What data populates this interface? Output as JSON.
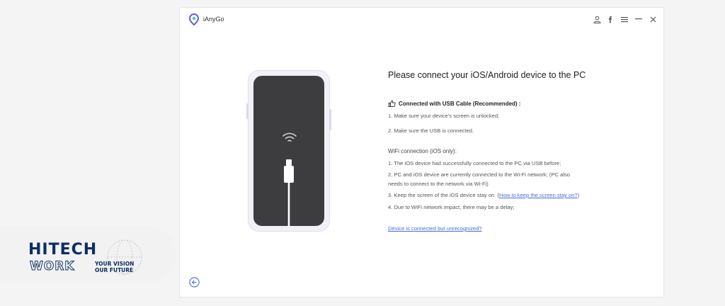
{
  "app": {
    "title": "iAnyGo",
    "accent": "#4a6bd8"
  },
  "titlebar": {
    "icons": [
      "user-icon",
      "facebook-icon",
      "menu-icon",
      "minimize-icon",
      "close-icon"
    ]
  },
  "phone": {
    "icons": [
      "wifi-icon",
      "usb-cable-icon"
    ]
  },
  "content": {
    "heading": "Please connect your iOS/Android device to the PC",
    "usb": {
      "title": "Connected with USB Cable (Recommended) :",
      "steps": [
        "1. Make sure your device's screen is unlocked;",
        "2. Make sure the USB is connected."
      ]
    },
    "wifi": {
      "title": "WiFi connection (iOS only):",
      "steps": [
        "1. The iOS device had successfully connected to the PC via USB before;",
        "2. PC and iOS device are currently connected to the Wi-Fi network; (PC also",
        "needs to connect to the network via Wi-Fi)",
        "3. Keep the screen of the iOS device stay on",
        "4. Due to WiFi network impact, there may be a delay;"
      ],
      "keep_on_link": "How to keep the screen stay on?"
    },
    "unrecognized_link": "Device is connected but unrecognized?"
  },
  "watermark": {
    "line1": "HITECH",
    "line2": "WORK",
    "tagline1": "YOUR VISION",
    "tagline2": "OUR FUTURE"
  }
}
